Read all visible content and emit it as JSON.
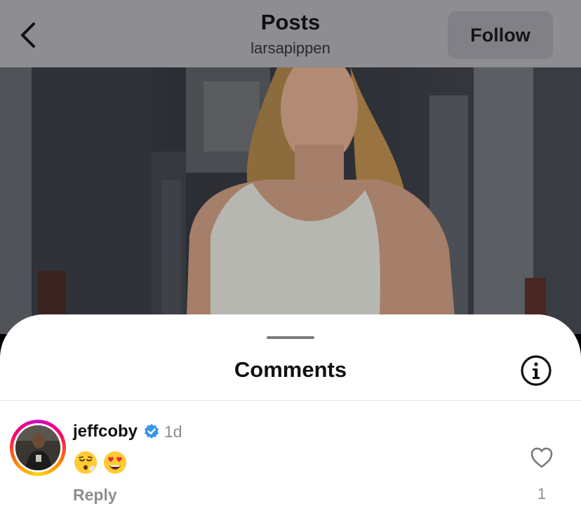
{
  "header": {
    "title": "Posts",
    "username": "larsapippen",
    "follow_label": "Follow"
  },
  "sheet": {
    "title": "Comments"
  },
  "comments": [
    {
      "username": "jeffcoby",
      "verified": true,
      "time": "1d",
      "text_emojis": [
        "😮‍💨",
        "😍"
      ],
      "reply_label": "Reply",
      "like_count": "1"
    }
  ],
  "colors": {
    "verified_blue": "#3797f0",
    "muted_text": "#8e8e8e",
    "dim_header": "#8d8d92"
  },
  "icons": {
    "back": "chevron-left-icon",
    "info": "info-icon",
    "like": "heart-outline-icon",
    "verified": "verified-badge-icon"
  }
}
